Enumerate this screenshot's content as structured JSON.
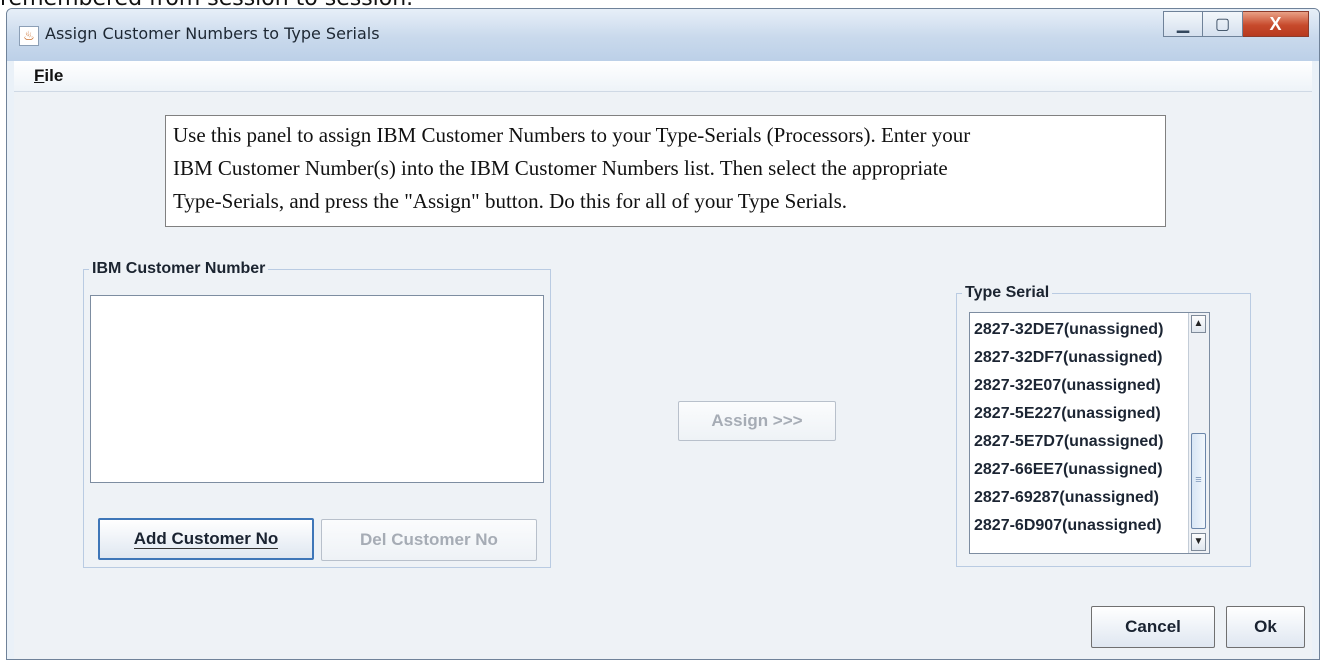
{
  "caption_above_window": "remembered from session to session.",
  "window": {
    "title": "Assign Customer Numbers to Type Serials",
    "icon": "java-cup-icon",
    "controls": {
      "minimize": "minimize-icon",
      "maximize": "maximize-icon",
      "close": "close-icon"
    },
    "minimize_glyph": "▁",
    "maximize_glyph": "▢",
    "close_glyph": "X"
  },
  "menu": {
    "file_mnemonic": "F",
    "file_rest": "ile"
  },
  "instructions": {
    "lines": [
      "Use this panel to assign IBM Customer Numbers to your Type-Serials (Processors).  Enter your",
      "IBM Customer Number(s) into the IBM Customer Numbers list.  Then select the appropriate",
      "Type-Serials, and press the \"Assign\" button.  Do this for all of your Type Serials."
    ]
  },
  "customer_panel": {
    "legend": "IBM Customer Number",
    "items": [],
    "add_button": "Add Customer No",
    "del_button": "Del Customer No"
  },
  "assign_button": "Assign >>>",
  "type_serial_panel": {
    "legend": "Type Serial",
    "items": [
      "2827-32DE7(unassigned)",
      "2827-32DF7(unassigned)",
      "2827-32E07(unassigned)",
      "2827-5E227(unassigned)",
      "2827-5E7D7(unassigned)",
      "2827-66EE7(unassigned)",
      "2827-69287(unassigned)",
      "2827-6D907(unassigned)"
    ],
    "scroll_up_glyph": "▲",
    "scroll_down_glyph": "▼",
    "thumb_glyph": "≡"
  },
  "footer": {
    "cancel": "Cancel",
    "ok": "Ok"
  },
  "colors": {
    "window_bg": "#eef2f6",
    "titlebar": "#c9d9ec",
    "close_button": "#c74a2c",
    "group_border": "#b9cbe2"
  }
}
